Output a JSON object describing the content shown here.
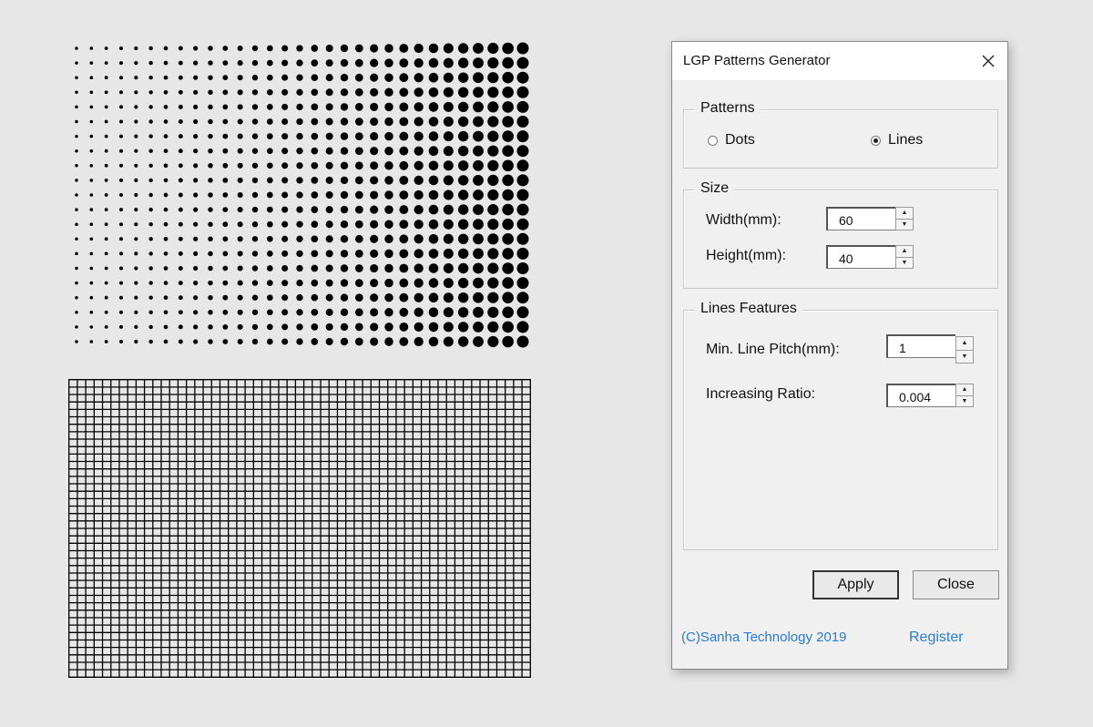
{
  "dialog": {
    "title": "LGP Patterns Generator",
    "patterns": {
      "label": "Patterns",
      "options": [
        {
          "label": "Dots",
          "checked": false
        },
        {
          "label": "Lines",
          "checked": true
        }
      ]
    },
    "size": {
      "label": "Size",
      "width_label": "Width(mm):",
      "width_value": "60",
      "height_label": "Height(mm):",
      "height_value": "40"
    },
    "lines_features": {
      "label": "Lines Features",
      "pitch_label": "Min. Line Pitch(mm):",
      "pitch_value": "1",
      "ratio_label": "Increasing Ratio:",
      "ratio_value": "0.004"
    },
    "buttons": {
      "apply": "Apply",
      "close": "Close"
    },
    "footer": {
      "copyright": "(C)Sanha Technology 2019",
      "register": "Register"
    }
  },
  "previews": {
    "dots": {
      "rows": 21,
      "cols": 31,
      "min_dot_diameter": 3.5,
      "max_dot_diameter": 13
    },
    "grid": {
      "cols": 55,
      "rows": 40
    }
  },
  "colors": {
    "link": "#2b7bd0",
    "background": "#e7e7e7",
    "dialog": "#f0f0f0"
  }
}
